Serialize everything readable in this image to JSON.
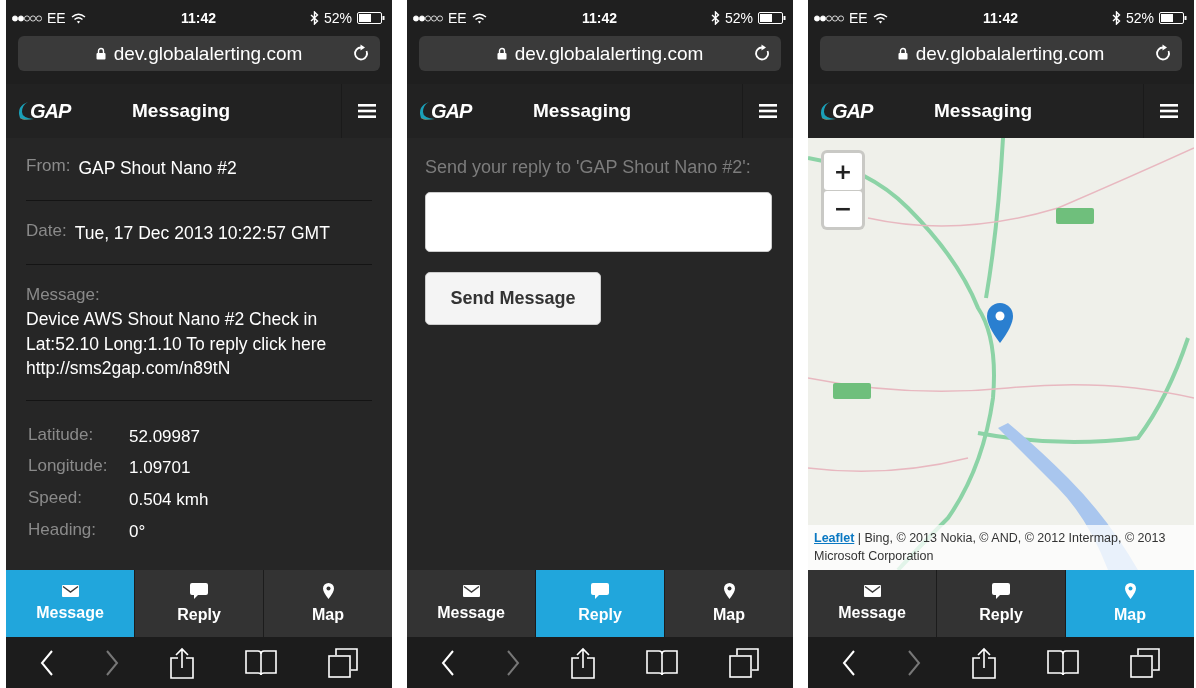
{
  "phones": [
    {
      "status_bar": {
        "carrier": "EE",
        "time": "11:42",
        "battery": "52%"
      },
      "address_bar": {
        "url": "dev.globalalerting.com"
      },
      "header": {
        "logo": "GAP",
        "title": "Messaging"
      },
      "screen": {
        "kind": "message",
        "fields": [
          {
            "label": "From:",
            "value": "GAP Shout Nano #2"
          },
          {
            "label": "Date:",
            "value": "Tue, 17 Dec 2013 10:22:57 GMT"
          }
        ],
        "message": {
          "label": "Message:",
          "text": "Device AWS Shout Nano #2 Check in Lat:52.10 Long:1.10 To reply click here http://sms2gap.com/n89tN"
        },
        "details": [
          {
            "label": "Latitude:",
            "value": "52.09987"
          },
          {
            "label": "Longitude:",
            "value": "1.09701"
          },
          {
            "label": "Speed:",
            "value": "0.504 kmh"
          },
          {
            "label": "Heading:",
            "value": "0°"
          }
        ]
      },
      "tabs": [
        {
          "label": "Message",
          "kind": "message",
          "selected": true
        },
        {
          "label": "Reply",
          "kind": "reply",
          "selected": false
        },
        {
          "label": "Map",
          "kind": "map",
          "selected": false
        }
      ]
    },
    {
      "status_bar": {
        "carrier": "EE",
        "time": "11:42",
        "battery": "52%"
      },
      "address_bar": {
        "url": "dev.globalalerting.com"
      },
      "header": {
        "logo": "GAP",
        "title": "Messaging"
      },
      "screen": {
        "kind": "reply",
        "prompt": "Send your reply to 'GAP Shout Nano #2':",
        "button": "Send Message"
      },
      "tabs": [
        {
          "label": "Message",
          "kind": "message",
          "selected": false
        },
        {
          "label": "Reply",
          "kind": "reply",
          "selected": true
        },
        {
          "label": "Map",
          "kind": "map",
          "selected": false
        }
      ]
    },
    {
      "status_bar": {
        "carrier": "EE",
        "time": "11:42",
        "battery": "52%"
      },
      "address_bar": {
        "url": "dev.globalalerting.com"
      },
      "header": {
        "logo": "GAP",
        "title": "Messaging"
      },
      "screen": {
        "kind": "map",
        "zoom_in": "+",
        "zoom_out": "−",
        "attribution_link": "Leaflet",
        "attribution": "| Bing, © 2013 Nokia, © AND, © 2012 Intermap, © 2013 Microsoft Corporation"
      },
      "tabs": [
        {
          "label": "Message",
          "kind": "message",
          "selected": false
        },
        {
          "label": "Reply",
          "kind": "reply",
          "selected": false
        },
        {
          "label": "Map",
          "kind": "map",
          "selected": true
        }
      ]
    }
  ]
}
